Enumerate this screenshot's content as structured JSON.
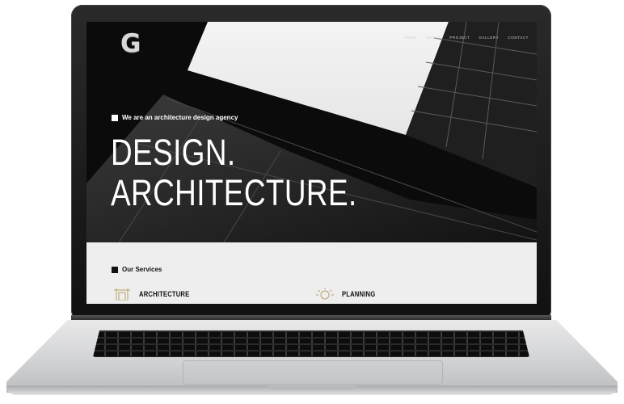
{
  "site": {
    "logo": "G",
    "nav": [
      "Home",
      "About",
      "Project",
      "Gallery",
      "Contact"
    ]
  },
  "hero": {
    "tagline": "We are an architecture design agency",
    "headline_line1": "DESIGN.",
    "headline_line2": "ARCHITECTURE."
  },
  "services": {
    "title": "Our Services",
    "items": [
      {
        "icon": "architecture-icon",
        "label": "ARCHITECTURE"
      },
      {
        "icon": "planning-icon",
        "label": "PLANNING"
      }
    ]
  },
  "colors": {
    "hero_background": "#0c0c0c",
    "services_background": "#eeeeee",
    "accent_icon": "#b8a36a"
  }
}
